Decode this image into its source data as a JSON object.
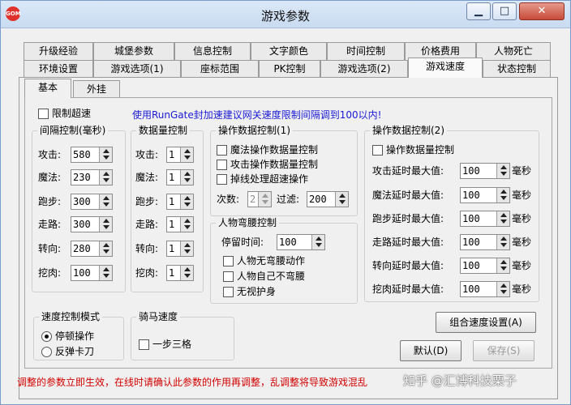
{
  "window": {
    "title": "游戏参数",
    "app_icon_text": "GOM",
    "controls": {
      "minimize": "▁",
      "maximize": "□",
      "close": "✕"
    }
  },
  "tabs_row1": [
    "升级经验",
    "城堡参数",
    "信息控制",
    "文字颜色",
    "时间控制",
    "价格费用",
    "人物死亡"
  ],
  "tabs_row2": [
    "环境设置",
    "游戏选项(1)",
    "座标范围",
    "PK控制",
    "游戏选项(2)",
    "游戏速度",
    "状态控制"
  ],
  "active_tab": "游戏速度",
  "subtabs": [
    "基本",
    "外挂"
  ],
  "limit_speed": {
    "label": "限制超速",
    "checked": false
  },
  "notice": "使用RunGate封加速建议网关速度限制间隔调到100以内!",
  "interval_group": {
    "title": "间隔控制(毫秒)",
    "rows": [
      {
        "label": "攻击:",
        "value": "580"
      },
      {
        "label": "魔法:",
        "value": "230"
      },
      {
        "label": "跑步:",
        "value": "300"
      },
      {
        "label": "走路:",
        "value": "300"
      },
      {
        "label": "转向:",
        "value": "280"
      },
      {
        "label": "挖肉:",
        "value": "100"
      }
    ]
  },
  "count_group": {
    "title": "数据量控制",
    "rows": [
      {
        "label": "攻击:",
        "value": "1"
      },
      {
        "label": "魔法:",
        "value": "1"
      },
      {
        "label": "跑步:",
        "value": "1"
      },
      {
        "label": "走路:",
        "value": "1"
      },
      {
        "label": "转向:",
        "value": "1"
      },
      {
        "label": "挖肉:",
        "value": "1"
      }
    ]
  },
  "op_group1": {
    "title": "操作数据控制(1)",
    "checks": [
      "魔法操作数据量控制",
      "攻击操作数据量控制",
      "掉线处理超速操作"
    ],
    "count_label": "次数:",
    "count_value": "2",
    "filter_label": "过滤:",
    "filter_value": "200"
  },
  "bow_group": {
    "title": "人物弯腰控制",
    "stay_label": "停留时间:",
    "stay_value": "100",
    "checks": [
      "人物无弯腰动作",
      "人物自己不弯腰",
      "无视护身"
    ]
  },
  "op_group2": {
    "title": "操作数据控制(2)",
    "check": "操作数据量控制",
    "unit": "毫秒",
    "rows": [
      {
        "label": "攻击延时最大值:",
        "value": "100"
      },
      {
        "label": "魔法延时最大值:",
        "value": "100"
      },
      {
        "label": "跑步延时最大值:",
        "value": "100"
      },
      {
        "label": "走路延时最大值:",
        "value": "100"
      },
      {
        "label": "转向延时最大值:",
        "value": "100"
      },
      {
        "label": "挖肉延时最大值:",
        "value": "100"
      }
    ]
  },
  "mode_group": {
    "title": "速度控制模式",
    "options": [
      {
        "label": "停顿操作",
        "checked": true
      },
      {
        "label": "反弹卡刀",
        "checked": false
      }
    ]
  },
  "horse_group": {
    "title": "骑马速度",
    "check": "一步三格"
  },
  "buttons": {
    "combine": "组合速度设置(A)",
    "default": "默认(D)",
    "save": "保存(S)"
  },
  "footer_note": "调整的参数立即生效，在线时请确认此参数的作用再调整，乱调整将导致游戏混乱",
  "watermark": "知乎 @汇博科技栗子"
}
